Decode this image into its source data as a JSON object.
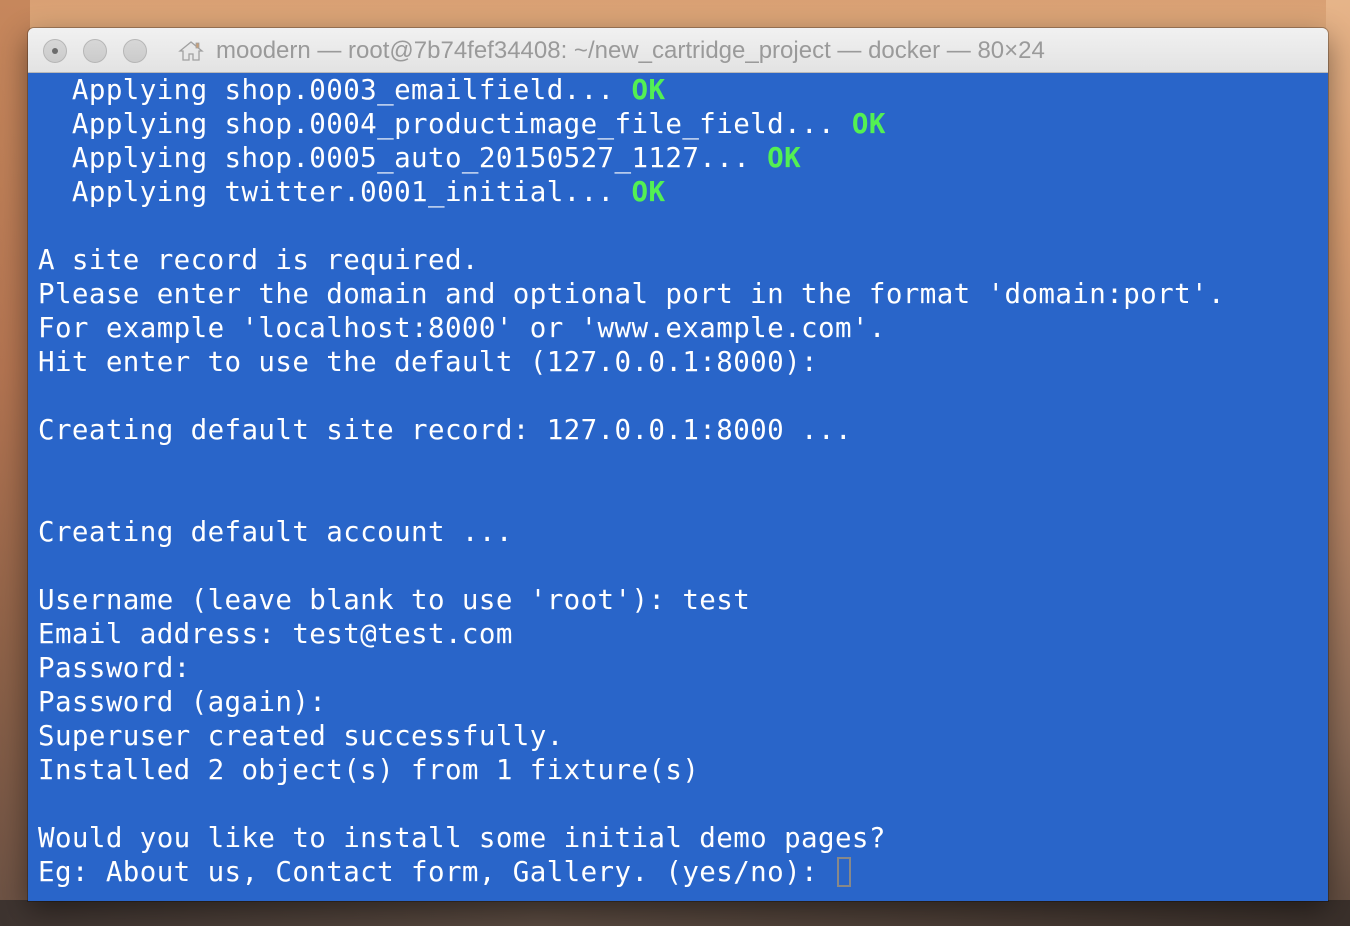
{
  "window": {
    "title": "moodern — root@7b74fef34408: ~/new_cartridge_project — docker — 80×24"
  },
  "terminal": {
    "lines": [
      {
        "text": "  Applying shop.0003_emailfield... ",
        "status": "OK"
      },
      {
        "text": "  Applying shop.0004_productimage_file_field... ",
        "status": "OK"
      },
      {
        "text": "  Applying shop.0005_auto_20150527_1127... ",
        "status": "OK"
      },
      {
        "text": "  Applying twitter.0001_initial... ",
        "status": "OK"
      },
      {
        "text": "",
        "status": ""
      },
      {
        "text": "A site record is required.",
        "status": ""
      },
      {
        "text": "Please enter the domain and optional port in the format 'domain:port'.",
        "status": ""
      },
      {
        "text": "For example 'localhost:8000' or 'www.example.com'.",
        "status": ""
      },
      {
        "text": "Hit enter to use the default (127.0.0.1:8000):",
        "status": ""
      },
      {
        "text": "",
        "status": ""
      },
      {
        "text": "Creating default site record: 127.0.0.1:8000 ...",
        "status": ""
      },
      {
        "text": "",
        "status": ""
      },
      {
        "text": "",
        "status": ""
      },
      {
        "text": "Creating default account ...",
        "status": ""
      },
      {
        "text": "",
        "status": ""
      },
      {
        "text": "Username (leave blank to use 'root'): test",
        "status": ""
      },
      {
        "text": "Email address: test@test.com",
        "status": ""
      },
      {
        "text": "Password:",
        "status": ""
      },
      {
        "text": "Password (again):",
        "status": ""
      },
      {
        "text": "Superuser created successfully.",
        "status": ""
      },
      {
        "text": "Installed 2 object(s) from 1 fixture(s)",
        "status": ""
      },
      {
        "text": "",
        "status": ""
      },
      {
        "text": "Would you like to install some initial demo pages?",
        "status": ""
      },
      {
        "text": "Eg: About us, Contact form, Gallery. (yes/no): ",
        "status": ""
      }
    ]
  },
  "colors": {
    "terminal_background": "#2965c9",
    "terminal_text": "#ffffff",
    "ok_status": "#53f053"
  },
  "icons": {
    "title": "home-icon"
  }
}
